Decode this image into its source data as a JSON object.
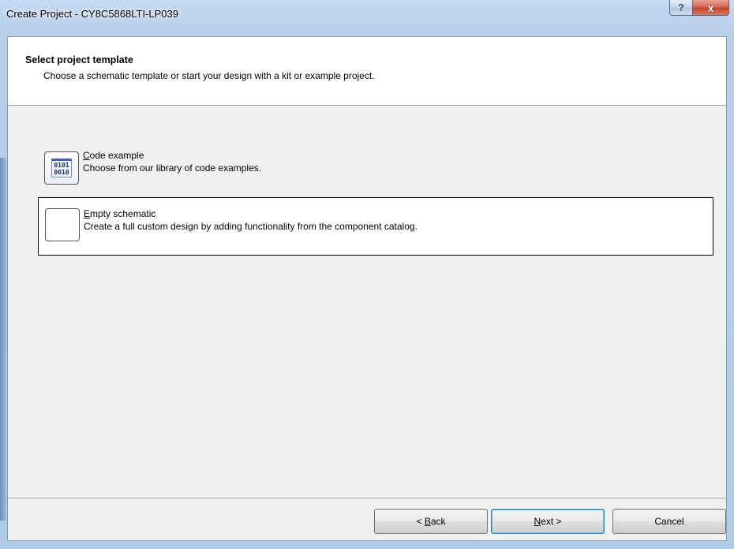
{
  "window": {
    "title": "Create Project - CY8C5868LTI-LP039",
    "help_symbol": "?",
    "close_symbol": "x"
  },
  "header": {
    "title": "Select project template",
    "subtitle": "Choose a schematic template or start your design with a kit or example project."
  },
  "options": [
    {
      "title_mnemonic": "C",
      "title_rest": "ode example",
      "description": "Choose from our library of code examples.",
      "icon": "binary-code-icon",
      "icon_text_top": "0101",
      "icon_text_bottom": "0010",
      "selected": false
    },
    {
      "title_mnemonic": "E",
      "title_rest": "mpty schematic",
      "description": "Create a full custom design by adding functionality from the component catalog.",
      "icon": "empty-schematic-icon",
      "selected": true
    }
  ],
  "buttons": {
    "back_prefix": "< ",
    "back_mnemonic": "B",
    "back_rest": "ack",
    "next_mnemonic": "N",
    "next_rest": "ext >",
    "cancel": "Cancel"
  },
  "colors": {
    "frame": "#b8cfe9",
    "client_bg": "#f0f0f0",
    "header_bg": "#ffffff",
    "close_button": "#c2432a",
    "default_button_border": "#3c7fb1"
  }
}
